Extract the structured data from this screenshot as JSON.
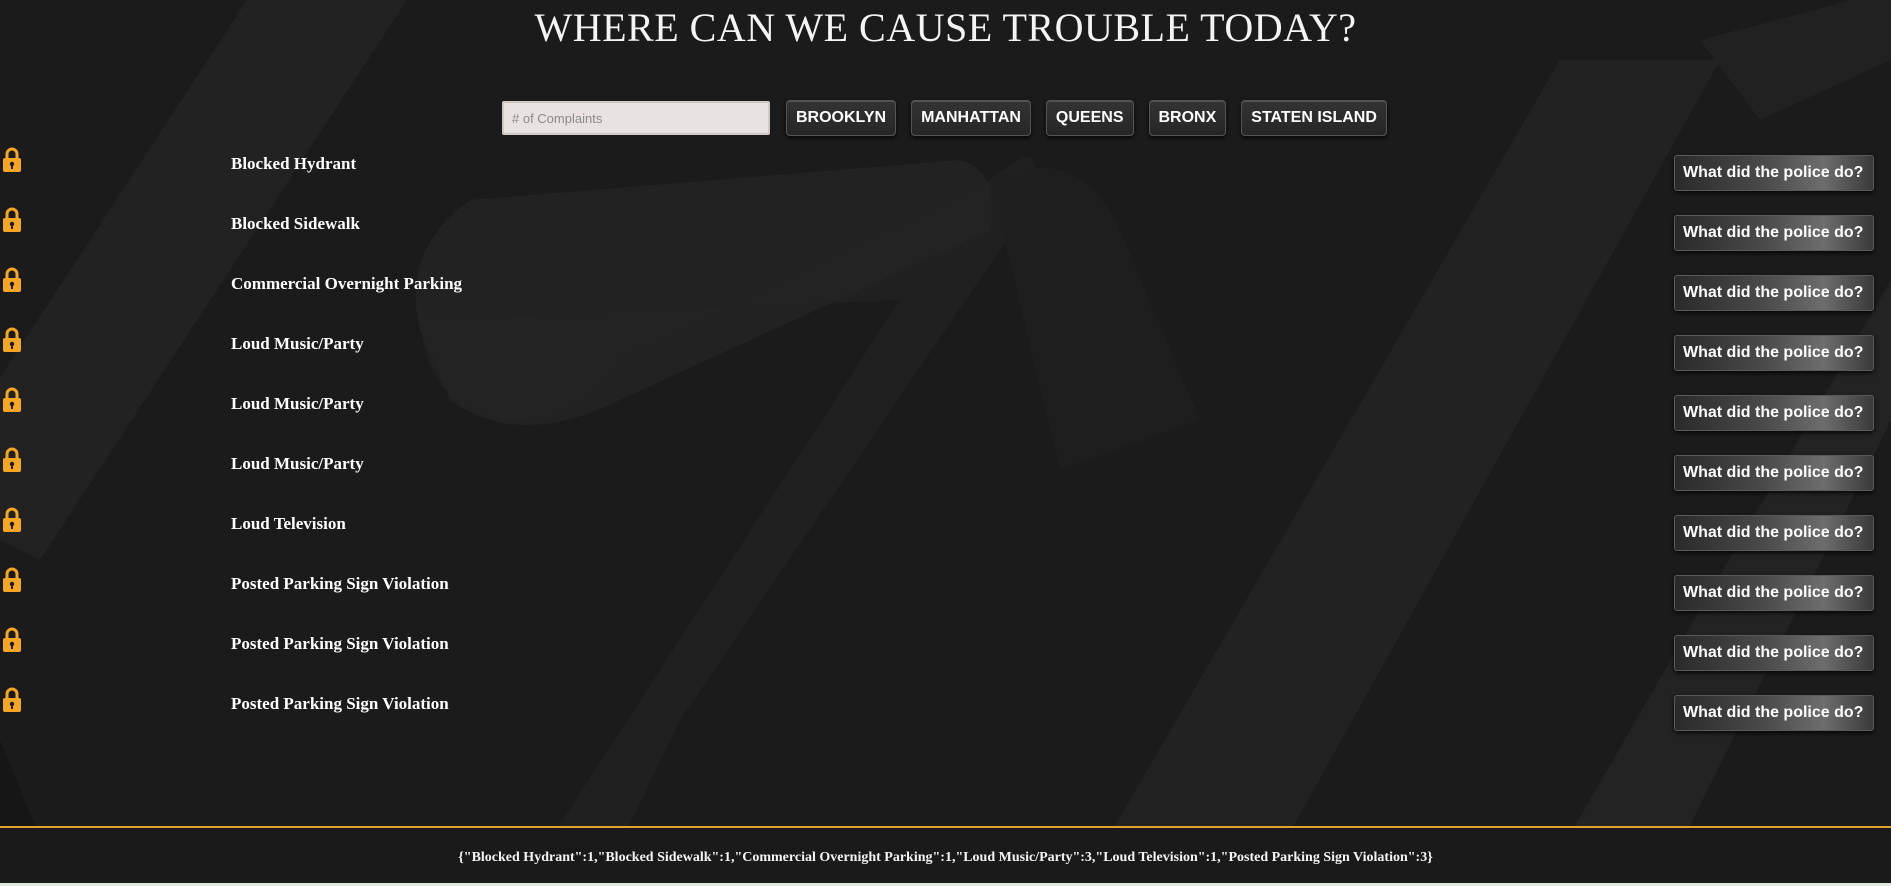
{
  "page": {
    "title": "WHERE CAN WE CAUSE TROUBLE TODAY?"
  },
  "search": {
    "placeholder": "# of Complaints",
    "value": ""
  },
  "boroughs": [
    {
      "label": "BROOKLYN"
    },
    {
      "label": "MANHATTAN"
    },
    {
      "label": "QUEENS"
    },
    {
      "label": "BRONX"
    },
    {
      "label": "STATEN ISLAND"
    }
  ],
  "complaints": [
    {
      "label": "Blocked Hydrant",
      "button": "What did the police do?",
      "icon": "lock-icon"
    },
    {
      "label": "Blocked Sidewalk",
      "button": "What did the police do?",
      "icon": "lock-icon"
    },
    {
      "label": "Commercial Overnight Parking",
      "button": "What did the police do?",
      "icon": "lock-icon"
    },
    {
      "label": "Loud Music/Party",
      "button": "What did the police do?",
      "icon": "lock-icon"
    },
    {
      "label": "Loud Music/Party",
      "button": "What did the police do?",
      "icon": "lock-icon"
    },
    {
      "label": "Loud Music/Party",
      "button": "What did the police do?",
      "icon": "lock-icon"
    },
    {
      "label": "Loud Television",
      "button": "What did the police do?",
      "icon": "lock-icon"
    },
    {
      "label": "Posted Parking Sign Violation",
      "button": "What did the police do?",
      "icon": "lock-icon"
    },
    {
      "label": "Posted Parking Sign Violation",
      "button": "What did the police do?",
      "icon": "lock-icon"
    },
    {
      "label": "Posted Parking Sign Violation",
      "button": "What did the police do?",
      "icon": "lock-icon"
    }
  ],
  "footer": {
    "summary": "{\"Blocked Hydrant\":1,\"Blocked Sidewalk\":1,\"Commercial Overnight Parking\":1,\"Loud Music/Party\":3,\"Loud Television\":1,\"Posted Parking Sign Violation\":3}"
  },
  "colors": {
    "background": "#1d1d1d",
    "lock": "#f5a623",
    "footer_border": "#e6a030"
  }
}
